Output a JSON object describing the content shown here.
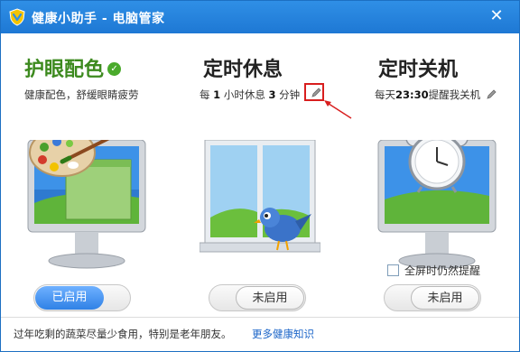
{
  "window": {
    "title": "健康小助手 - 电脑管家",
    "close_glyph": "✕"
  },
  "eye_care": {
    "title": "护眼配色",
    "check_glyph": "✓",
    "subtitle": "健康配色，舒缓眼睛疲劳",
    "toggle_label": "已启用",
    "enabled": true
  },
  "rest": {
    "title": "定时休息",
    "sub_prefix": "每",
    "interval_hours": "1",
    "sub_mid": "小时休息",
    "rest_minutes": "3",
    "sub_suffix": "分钟",
    "toggle_label": "未启用",
    "enabled": false
  },
  "shutdown": {
    "title": "定时关机",
    "sub_prefix": "每天",
    "time": "23:30",
    "sub_suffix": "提醒我关机",
    "fullscreen_label": "全屏时仍然提醒",
    "fullscreen_checked": false,
    "toggle_label": "未启用",
    "enabled": false
  },
  "footer": {
    "tip": "过年吃剩的蔬菜尽量少食用，特别是老年朋友。",
    "more_link": "更多健康知识"
  },
  "icons": [
    "shield-logo-icon",
    "close-icon",
    "check-icon",
    "edit-pencil-icon",
    "paint-palette-icon",
    "window-icon",
    "bird-icon",
    "alarm-clock-icon",
    "checkbox-icon"
  ],
  "colors": {
    "titlebar": "#1e78d4",
    "eye_care_title": "#3d8a1f",
    "toggle_on": "#2f81e6",
    "highlight_box": "#d81e1e",
    "link": "#1a64c8"
  }
}
